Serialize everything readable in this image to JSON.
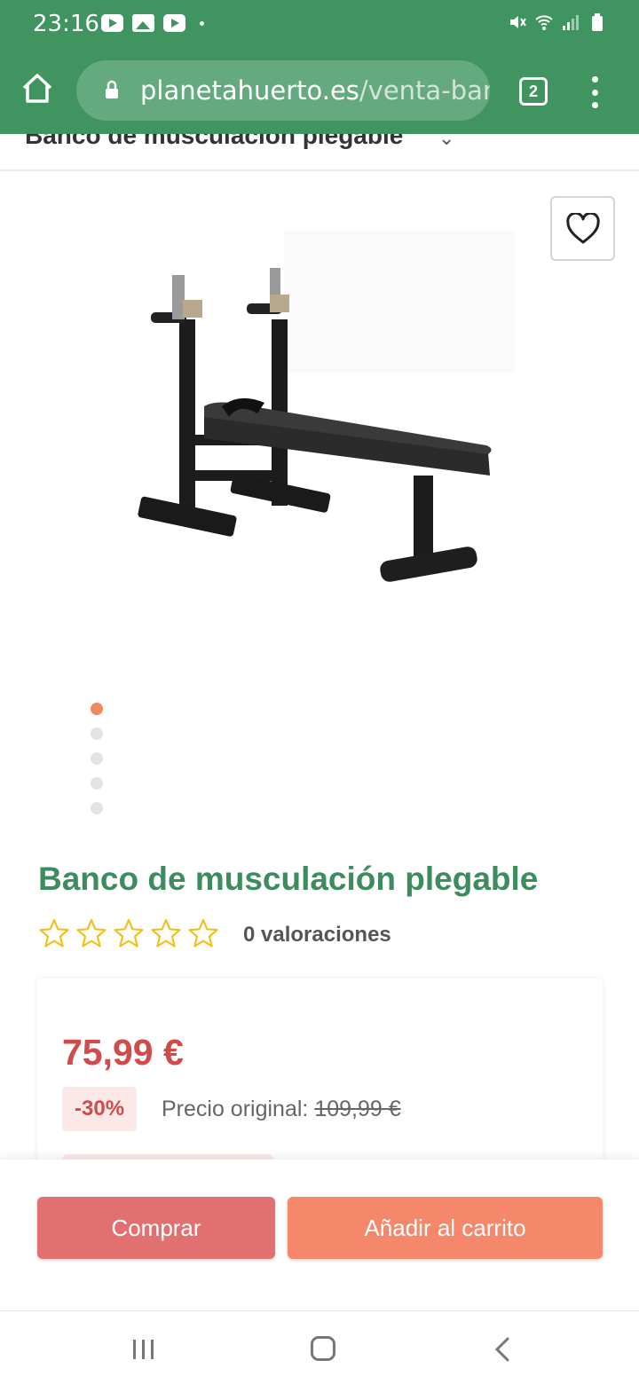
{
  "status_bar": {
    "time": "23:16"
  },
  "browser": {
    "domain": "planetahuerto.es",
    "path": "/venta-ban",
    "tabs_count": "2"
  },
  "sticky_header": {
    "title": "Banco de musculación plegable"
  },
  "gallery": {
    "total_images": 5,
    "active_index": 0
  },
  "product": {
    "title": "Banco de musculación plegable",
    "rating": 0,
    "reviews_label": "0 valoraciones",
    "price": "75,99 €",
    "discount": "-30%",
    "original_price_label": "Precio original: ",
    "original_price": "109,99 €"
  },
  "actions": {
    "buy_label": "Comprar",
    "cart_label": "Añadir al carrito"
  },
  "colors": {
    "brand_green": "#3f9460",
    "title_green": "#3c8c5d",
    "price_red": "#d14b4b",
    "buy_button": "#e27070",
    "cart_button": "#f5876a",
    "star": "#f2c01e",
    "dot_active": "#f08a5d"
  }
}
